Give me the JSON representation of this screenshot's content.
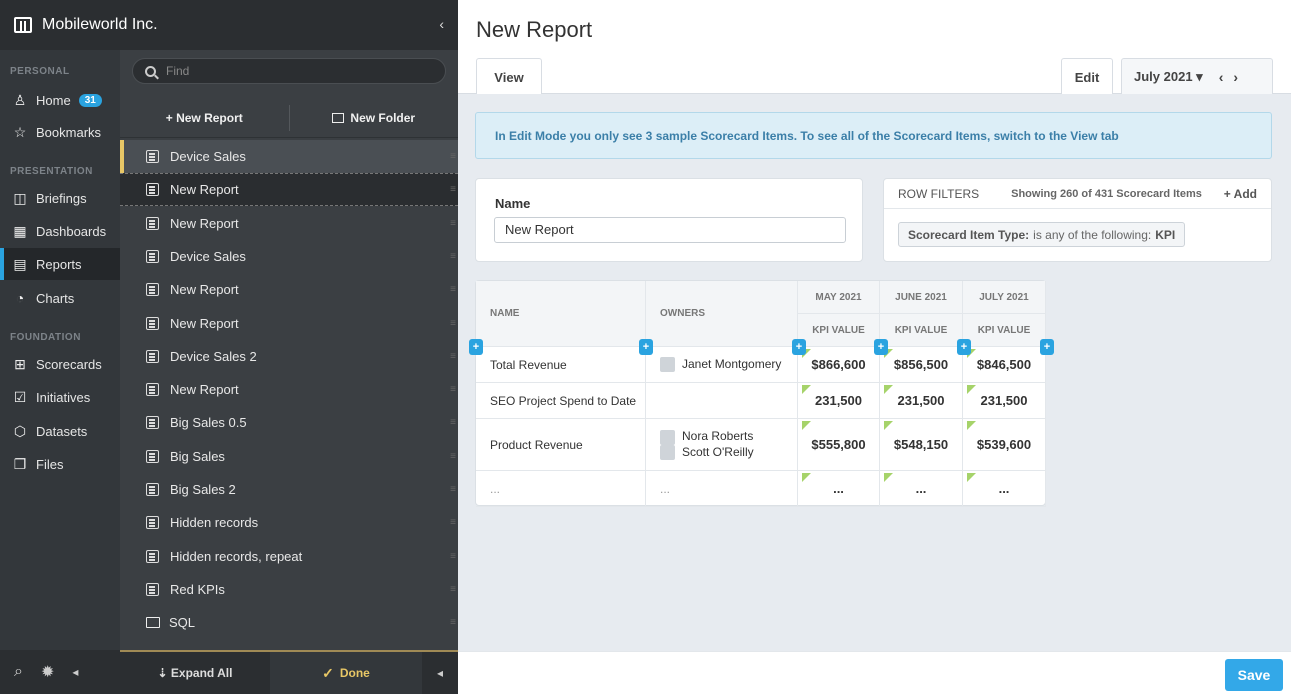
{
  "org": {
    "name": "Mobileworld Inc.",
    "collapse_glyph": "‹"
  },
  "nav": {
    "personal_label": "PERSONAL",
    "presentation_label": "PRESENTATION",
    "foundation_label": "FOUNDATION",
    "home": {
      "label": "Home",
      "badge": "31"
    },
    "bookmarks": "Bookmarks",
    "briefings": "Briefings",
    "dashboards": "Dashboards",
    "reports": "Reports",
    "charts": "Charts",
    "scorecards": "Scorecards",
    "initiatives": "Initiatives",
    "datasets": "Datasets",
    "files": "Files",
    "bottom_arrow": "◂"
  },
  "list": {
    "search_placeholder": "Find",
    "new_report": "+ New Report",
    "new_folder": "New Folder",
    "items": [
      "Device Sales",
      "New Report",
      "New Report",
      "Device Sales",
      "New Report",
      "New Report",
      "Device Sales 2",
      "New Report",
      "Big Sales 0.5",
      "Big Sales",
      "Big Sales 2",
      "Hidden records",
      "Hidden records, repeat",
      "Red KPIs",
      "SQL"
    ],
    "expand_all": "Expand All",
    "done": "Done",
    "done_check": "✓",
    "collapse_arrow": "◂"
  },
  "main": {
    "title": "New Report",
    "tab_view": "View",
    "tab_edit": "Edit",
    "period": "July 2021 ▾",
    "prev": "‹",
    "next": "›",
    "info": "In Edit Mode you only see 3 sample Scorecard Items. To see all of the Scorecard Items, switch to the View tab",
    "name_label": "Name",
    "name_value": "New Report",
    "filters_title": "ROW FILTERS",
    "filters_count": "Showing 260 of 431 Scorecard Items",
    "filters_add": "+ Add",
    "filter_chip_key": "Scorecard Item Type:",
    "filter_chip_text": "is any of the following:",
    "filter_chip_value": "KPI",
    "save": "Save"
  },
  "table": {
    "col_name": "NAME",
    "col_owners": "OWNERS",
    "months": [
      "MAY 2021",
      "JUNE 2021",
      "JULY 2021"
    ],
    "sub": "KPI VALUE",
    "add_glyph": "+",
    "rows": [
      {
        "name": "Total Revenue",
        "owners": [
          "Janet Montgomery"
        ],
        "values": [
          "$866,600",
          "$856,500",
          "$846,500"
        ]
      },
      {
        "name": "SEO Project Spend to Date",
        "owners": [],
        "values": [
          "231,500",
          "231,500",
          "231,500"
        ]
      },
      {
        "name": "Product Revenue",
        "owners": [
          "Nora Roberts",
          "Scott O'Reilly"
        ],
        "values": [
          "$555,800",
          "$548,150",
          "$539,600"
        ]
      },
      {
        "name": "...",
        "owners": [
          "..."
        ],
        "values": [
          "...",
          "...",
          "..."
        ]
      }
    ]
  }
}
